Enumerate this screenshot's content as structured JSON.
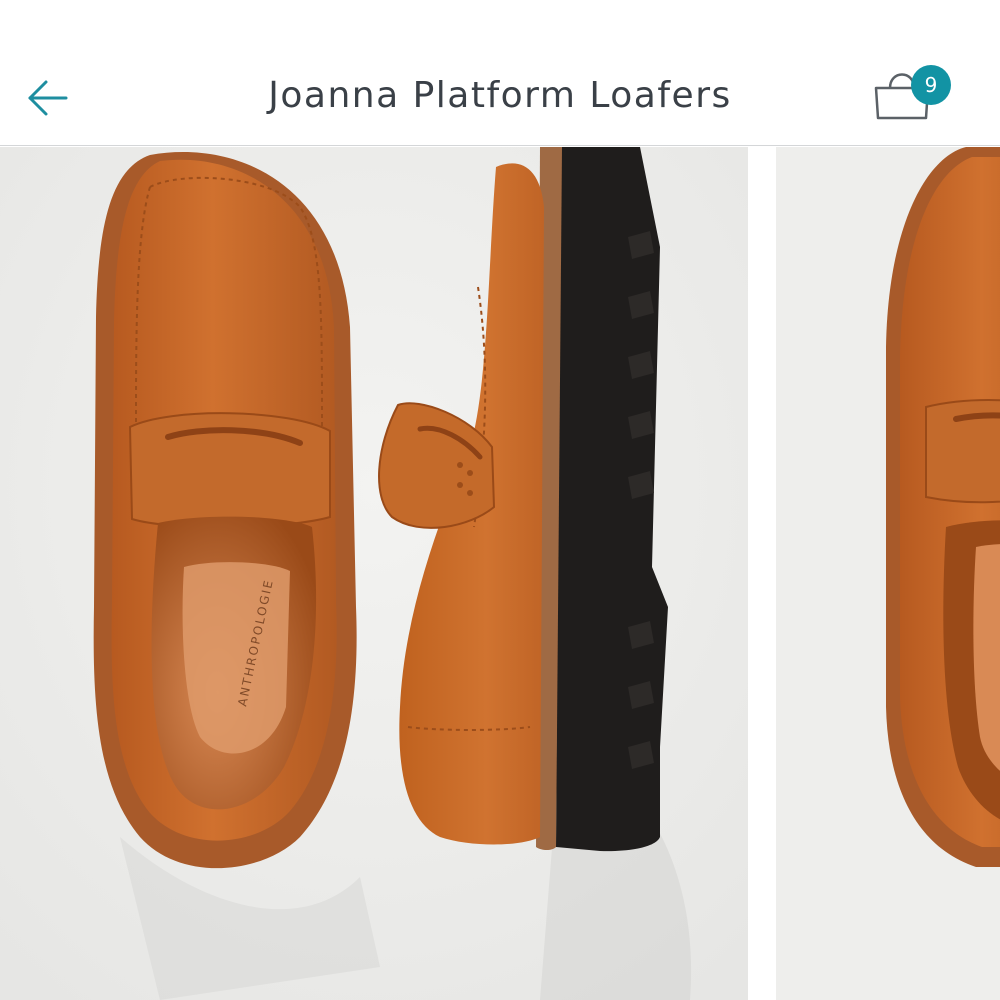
{
  "header": {
    "title": "Joanna Platform Loafers",
    "back_icon": "arrow-left-icon",
    "bag_icon": "shopping-bag-icon",
    "bag_count": "9"
  },
  "gallery": {
    "current_image": {
      "alt": "Joanna Platform Loafers",
      "colors": {
        "suede": "#c66628",
        "sole": "#1f1d1c",
        "background": "#eeeeec"
      }
    },
    "next_image": {
      "alt": "Joanna Platform Loafers"
    }
  },
  "colors": {
    "accent": "#1293a4",
    "title_text": "#3a4047"
  }
}
